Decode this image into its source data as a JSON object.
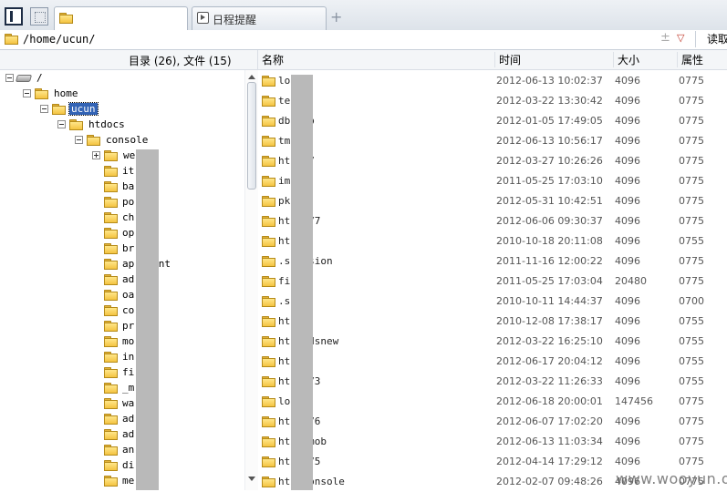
{
  "tabs": {
    "active_label": "",
    "schedule_label": "日程提醒",
    "add_label": "+"
  },
  "address": {
    "path": "/home/ucun/",
    "pm_symbol": "±",
    "dropdown_symbol": "▽",
    "read_button": "读取"
  },
  "left_pane": {
    "header": "目录 (26), 文件 (15)",
    "tree": [
      {
        "label": "/",
        "depth": 0,
        "expander": "minus",
        "icon": "drive"
      },
      {
        "label": "home",
        "depth": 1,
        "expander": "minus",
        "icon": "folder"
      },
      {
        "label": "ucun",
        "depth": 2,
        "expander": "minus",
        "icon": "folder",
        "selected": true
      },
      {
        "label": "htdocs",
        "depth": 3,
        "expander": "minus",
        "icon": "folder"
      },
      {
        "label": "console",
        "depth": 4,
        "expander": "minus",
        "icon": "folder"
      },
      {
        "label": "we",
        "depth": 5,
        "expander": "plus",
        "icon": "folder"
      },
      {
        "label": "it    ak",
        "depth": 5,
        "expander": "none",
        "icon": "folder"
      },
      {
        "label": "ba    e",
        "depth": 5,
        "expander": "none",
        "icon": "folder"
      },
      {
        "label": "po",
        "depth": 5,
        "expander": "none",
        "icon": "folder"
      },
      {
        "label": "ch    l",
        "depth": 5,
        "expander": "none",
        "icon": "folder"
      },
      {
        "label": "op",
        "depth": 5,
        "expander": "none",
        "icon": "folder"
      },
      {
        "label": "br",
        "depth": 5,
        "expander": "none",
        "icon": "folder"
      },
      {
        "label": "ap    tment",
        "depth": 5,
        "expander": "none",
        "icon": "folder"
      },
      {
        "label": "ad",
        "depth": 5,
        "expander": "none",
        "icon": "folder"
      },
      {
        "label": "oa    pt",
        "depth": 5,
        "expander": "none",
        "icon": "folder"
      },
      {
        "label": "co    y",
        "depth": 5,
        "expander": "none",
        "icon": "folder"
      },
      {
        "label": "pr    t",
        "depth": 5,
        "expander": "none",
        "icon": "folder"
      },
      {
        "label": "mo    r",
        "depth": 5,
        "expander": "none",
        "icon": "folder"
      },
      {
        "label": "in",
        "depth": 5,
        "expander": "none",
        "icon": "folder"
      },
      {
        "label": "fi    e",
        "depth": 5,
        "expander": "none",
        "icon": "folder"
      },
      {
        "label": "_m",
        "depth": 5,
        "expander": "none",
        "icon": "folder"
      },
      {
        "label": "wa    g",
        "depth": 5,
        "expander": "none",
        "icon": "folder"
      },
      {
        "label": "ad    r",
        "depth": 5,
        "expander": "none",
        "icon": "folder"
      },
      {
        "label": "ad",
        "depth": 5,
        "expander": "none",
        "icon": "folder"
      },
      {
        "label": "an    is",
        "depth": 5,
        "expander": "none",
        "icon": "folder"
      },
      {
        "label": "di",
        "depth": 5,
        "expander": "none",
        "icon": "folder"
      },
      {
        "label": "me",
        "depth": 5,
        "expander": "none",
        "icon": "folder"
      }
    ]
  },
  "file_list": {
    "columns": {
      "name": "名称",
      "time": "时间",
      "size": "大小",
      "attr": "属性"
    },
    "rows": [
      {
        "name": "lo",
        "time": "2012-06-13 10:02:37",
        "size": "4096",
        "attr": "0775"
      },
      {
        "name": "te",
        "time": "2012-03-22 13:30:42",
        "size": "4096",
        "attr": "0775"
      },
      {
        "name": "db    cup",
        "time": "2012-01-05 17:49:05",
        "size": "4096",
        "attr": "0775"
      },
      {
        "name": "tm",
        "time": "2012-06-13 10:56:17",
        "size": "4096",
        "attr": "0775"
      },
      {
        "name": "ht    _v7",
        "time": "2012-03-27 10:26:26",
        "size": "4096",
        "attr": "0775"
      },
      {
        "name": "im",
        "time": "2011-05-25 17:03:10",
        "size": "4096",
        "attr": "0775"
      },
      {
        "name": "pk",
        "time": "2012-05-31 10:42:51",
        "size": "4096",
        "attr": "0775"
      },
      {
        "name": "ht    _v77",
        "time": "2012-06-06 09:30:37",
        "size": "4096",
        "attr": "0775"
      },
      {
        "name": "ht    2",
        "time": "2010-10-18 20:11:08",
        "size": "4096",
        "attr": "0755"
      },
      {
        "name": ".s    ersion",
        "time": "2011-11-16 12:00:22",
        "size": "4096",
        "attr": "0775"
      },
      {
        "name": "fi",
        "time": "2011-05-25 17:03:04",
        "size": "20480",
        "attr": "0775"
      },
      {
        "name": ".s",
        "time": "2010-10-11 14:44:37",
        "size": "4096",
        "attr": "0700"
      },
      {
        "name": "ht    1",
        "time": "2010-12-08 17:38:17",
        "size": "4096",
        "attr": "0755"
      },
      {
        "name": "ht    _adsnew",
        "time": "2012-03-22 16:25:10",
        "size": "4096",
        "attr": "0755"
      },
      {
        "name": "ht",
        "time": "2012-06-17 20:04:12",
        "size": "4096",
        "attr": "0755"
      },
      {
        "name": "ht    _v73",
        "time": "2012-03-22 11:26:33",
        "size": "4096",
        "attr": "0755"
      },
      {
        "name": "lo",
        "time": "2012-06-18 20:00:01",
        "size": "147456",
        "attr": "0775"
      },
      {
        "name": "ht    _v76",
        "time": "2012-06-07 17:02:20",
        "size": "4096",
        "attr": "0775"
      },
      {
        "name": "ht    _umob",
        "time": "2012-06-13 11:03:34",
        "size": "4096",
        "attr": "0775"
      },
      {
        "name": "ht    _v75",
        "time": "2012-04-14 17:29:12",
        "size": "4096",
        "attr": "0775"
      },
      {
        "name": "ht    _console",
        "time": "2012-02-07 09:48:26",
        "size": "4096",
        "attr": "0775"
      }
    ]
  },
  "watermark": "www.wooyun.org"
}
